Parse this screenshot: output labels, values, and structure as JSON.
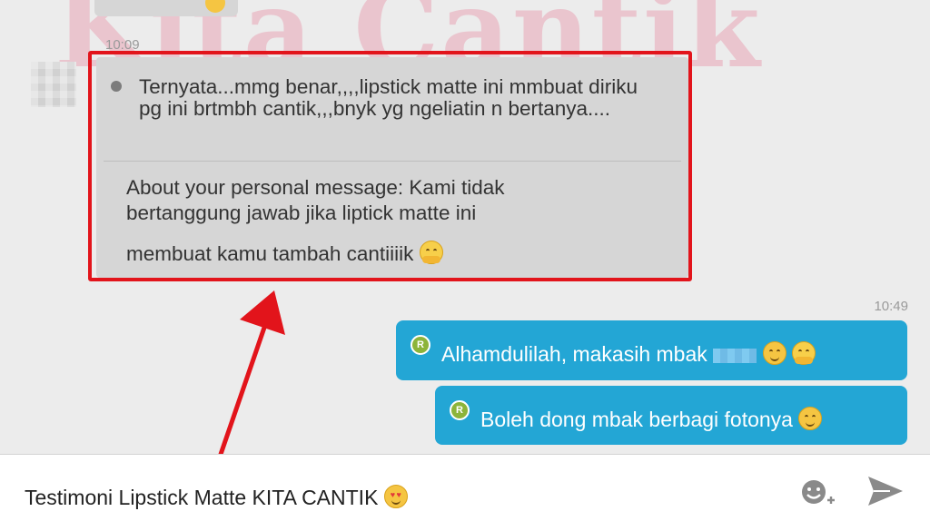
{
  "watermark": "Kita Cantik",
  "top_message": {
    "text": "..."
  },
  "incoming": {
    "timestamp": "10:09",
    "quote": "Ternyata...mmg benar,,,,lipstick matte ini mmbuat diriku pg ini brtmbh cantik,,,bnyk yg ngeliatin n bertanya....",
    "reply_line1": "About your personal message: Kami tidak",
    "reply_line2": "bertanggung jawab jika liptick matte ini",
    "reply_line3": "membuat kamu tambah cantiiiik"
  },
  "outgoing": {
    "timestamp": "10:49",
    "messages": [
      {
        "badge": "R",
        "text": "Alhamdulilah, makasih mbak"
      },
      {
        "badge": "R",
        "text": "Boleh dong mbak berbagi fotonya"
      }
    ]
  },
  "composer": {
    "text": "Testimoni Lipstick Matte KITA CANTIK",
    "icons": [
      "emoji-add-icon",
      "send-icon"
    ]
  },
  "colors": {
    "outgoing_bubble": "#23a6d5",
    "incoming_bubble": "#d6d6d6",
    "highlight": "#e2141b",
    "background": "#ececec"
  }
}
